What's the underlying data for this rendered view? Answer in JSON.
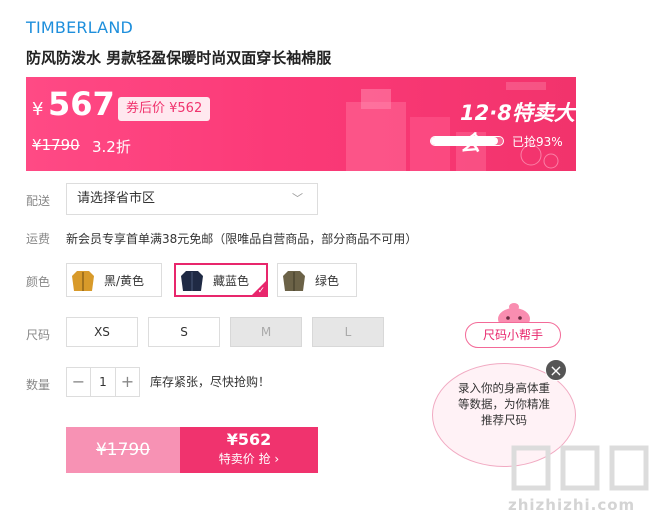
{
  "brand": "TIMBERLAND",
  "product_title": "防风防泼水 男款轻盈保暖时尚双面穿长袖棉服",
  "banner": {
    "currency": "¥",
    "price": "567",
    "coupon_label": "券后价 ¥562",
    "original_price": "¥1790",
    "discount": "3.2折",
    "event_title": "12·8特卖大会",
    "sold_text": "已抢93%",
    "sold_fraction": 0.93
  },
  "delivery": {
    "label": "配送",
    "placeholder": "请选择省市区"
  },
  "freight": {
    "label": "运费",
    "text": "新会员专享首单满38元免邮（限唯品自营商品，部分商品不可用）"
  },
  "colors": {
    "label": "颜色",
    "options": [
      {
        "name": "黑/黄色",
        "swatch": "#d89a2a",
        "selected": false
      },
      {
        "name": "藏蓝色",
        "swatch": "#1f2a44",
        "selected": true
      },
      {
        "name": "绿色",
        "swatch": "#6b6247",
        "selected": false
      }
    ]
  },
  "sizes": {
    "label": "尺码",
    "options": [
      {
        "name": "XS",
        "available": true
      },
      {
        "name": "S",
        "available": true
      },
      {
        "name": "M",
        "available": false
      },
      {
        "name": "L",
        "available": false
      }
    ]
  },
  "quantity": {
    "label": "数量",
    "minus": "−",
    "value": "1",
    "plus": "+",
    "stock_text": "库存紧张，尽快抢购！"
  },
  "actions": {
    "original_price": "¥1790",
    "buy_price": "¥562",
    "buy_label": "特卖价 抢 ›"
  },
  "size_helper": {
    "title": "尺码小帮手",
    "message": "录入你的身高体重等数据，为你精准推荐尺码",
    "close": "×"
  },
  "watermark": "zhizhizhi.com",
  "colors_theme": {
    "accent": "#f0336e",
    "link": "#1e8fdc",
    "banner_start": "#ff4a85"
  }
}
